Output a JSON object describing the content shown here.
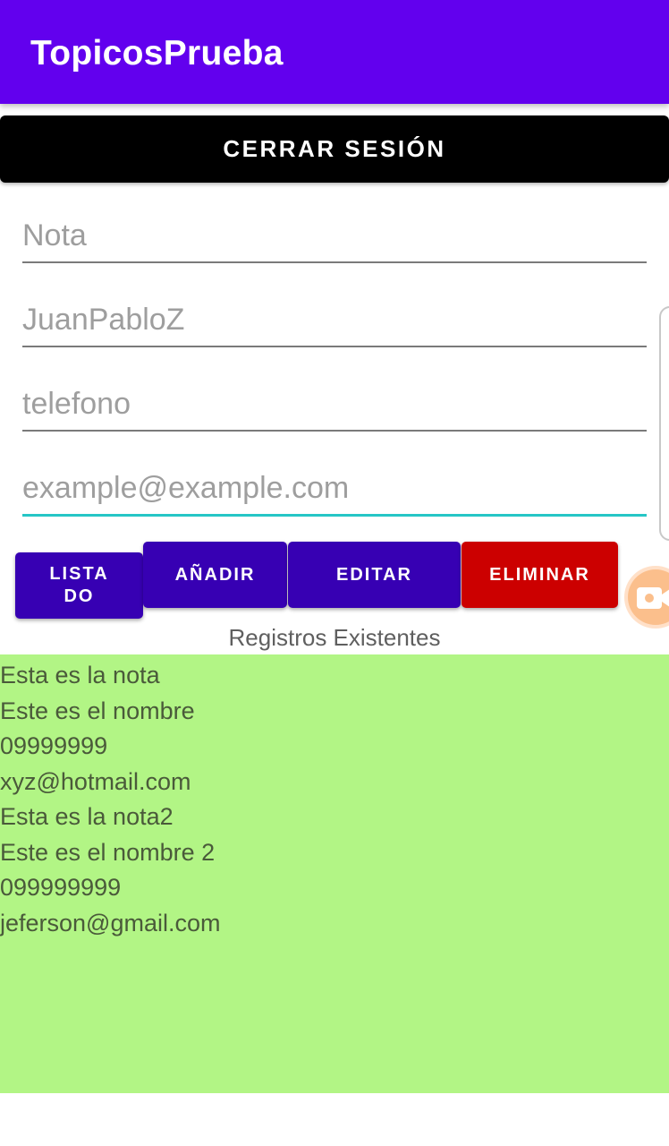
{
  "app_bar": {
    "title": "TopicosPrueba",
    "color": "#6200ee"
  },
  "logout_button": {
    "label": "CERRAR SESIÓN"
  },
  "form": {
    "nota_placeholder": "Nota",
    "nombre_placeholder": "JuanPabloZ",
    "telefono_placeholder": "telefono",
    "email_placeholder": "example@example.com",
    "focused_field_color": "#26c6c6"
  },
  "actions": {
    "listado_label": "LISTA\nDO",
    "anadir_label": "AÑADIR",
    "editar_label": "EDITAR",
    "eliminar_label": "ELIMINAR",
    "primary_color": "#3700b3",
    "danger_color": "#cc0000"
  },
  "floating_button": {
    "icon": "video-camera-icon"
  },
  "records": {
    "heading": "Registros Existentes",
    "background": "#b2f585",
    "lines": [
      "Esta es la nota",
      "Este es el nombre",
      "09999999",
      "xyz@hotmail.com",
      "Esta es la nota2",
      "Este es el nombre 2",
      "099999999",
      "jeferson@gmail.com"
    ]
  }
}
